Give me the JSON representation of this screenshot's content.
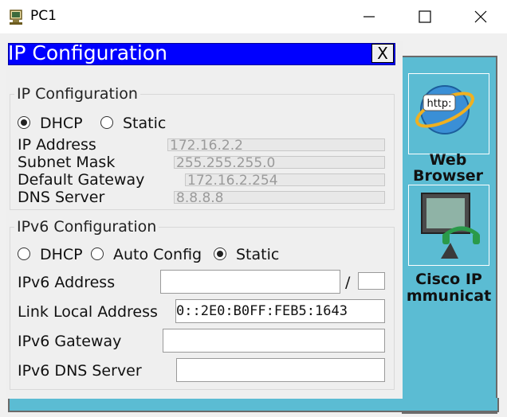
{
  "window": {
    "title": "PC1",
    "icon": "pc-icon",
    "controls": {
      "minimize": "minimize-icon",
      "maximize": "maximize-icon",
      "close": "close-icon"
    }
  },
  "desktop": {
    "apps": [
      {
        "label": "Web Browser",
        "line1": "Web",
        "line2": "Browser",
        "icon": "http-globe-icon"
      },
      {
        "label": "Cisco IP Communicator",
        "line1": "Cisco IP",
        "line2": "mmunicat",
        "icon": "ip-phone-icon"
      }
    ]
  },
  "dialog": {
    "title": "IP Configuration",
    "close_label": "X",
    "ipv4": {
      "group_title": "IP Configuration",
      "mode_selected": "DHCP",
      "dhcp_label": "DHCP",
      "static_label": "Static",
      "ip_address_label": "IP Address",
      "ip_address": "172.16.2.2",
      "subnet_mask_label": "Subnet Mask",
      "subnet_mask": "255.255.255.0",
      "gateway_label": "Default Gateway",
      "gateway": "172.16.2.254",
      "dns_label": "DNS Server",
      "dns": "8.8.8.8"
    },
    "ipv6": {
      "group_title": "IPv6 Configuration",
      "mode_selected": "Static",
      "dhcp_label": "DHCP",
      "auto_label": "Auto Config",
      "static_label": "Static",
      "address_label": "IPv6 Address",
      "address": "",
      "prefix_separator": "/",
      "prefix": "",
      "link_local_label": "Link Local Address",
      "link_local": "0::2E0:B0FF:FEB5:1643",
      "gateway_label": "IPv6 Gateway",
      "gateway": "",
      "dns_label": "IPv6 DNS Server",
      "dns": ""
    }
  },
  "colors": {
    "dialog_title_bg": "#0000ff",
    "desktop_bg": "#5bbcd3",
    "dialog_bg": "#efefef"
  }
}
